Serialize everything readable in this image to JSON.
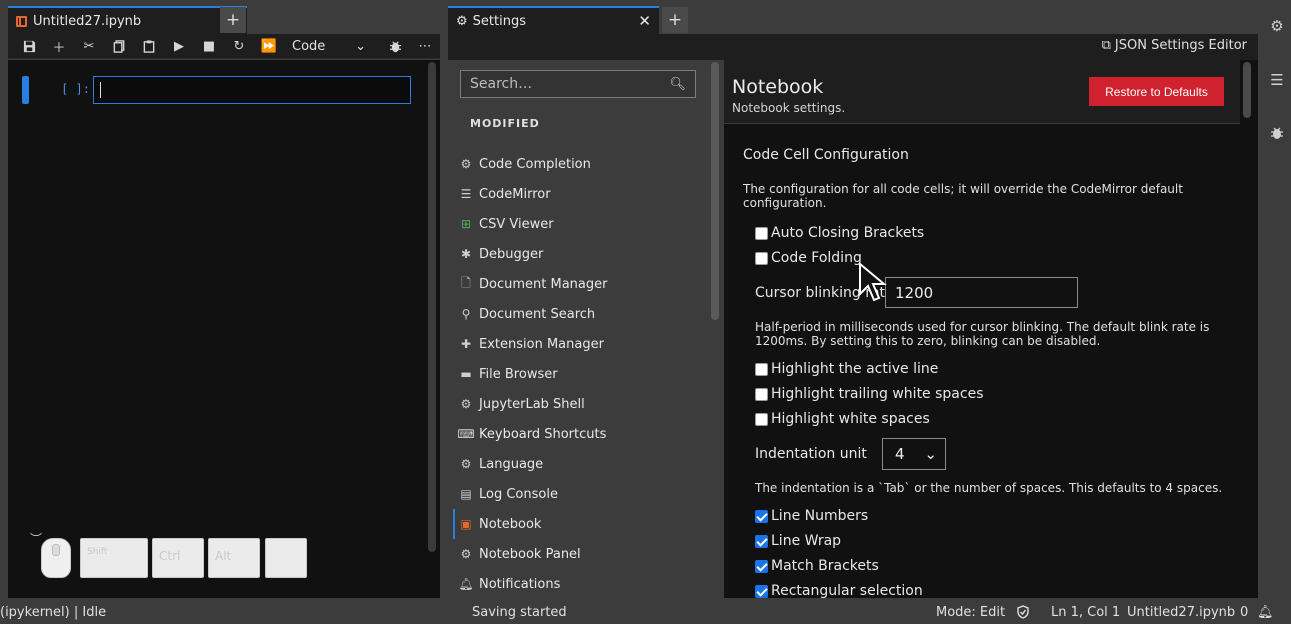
{
  "notebook_tab": {
    "title": "Untitled27.ipynb"
  },
  "toolbar": {
    "cell_type": "Code"
  },
  "cell": {
    "prompt": "[ ]:"
  },
  "key_overlay": {
    "keys": [
      "Shift",
      "Ctrl",
      "Alt",
      ""
    ]
  },
  "settings_tab": {
    "title": "Settings"
  },
  "settings_header": {
    "json_editor_label": "JSON Settings Editor"
  },
  "search": {
    "placeholder": "Search…"
  },
  "plugin_list": {
    "section_header": "MODIFIED",
    "items": [
      {
        "label": "Code Completion",
        "icon": "gear-icon"
      },
      {
        "label": "CodeMirror",
        "icon": "text-lines-icon"
      },
      {
        "label": "CSV Viewer",
        "icon": "spreadsheet-icon"
      },
      {
        "label": "Debugger",
        "icon": "bug-icon"
      },
      {
        "label": "Document Manager",
        "icon": "file-icon"
      },
      {
        "label": "Document Search",
        "icon": "search-icon"
      },
      {
        "label": "Extension Manager",
        "icon": "puzzle-icon"
      },
      {
        "label": "File Browser",
        "icon": "folder-icon"
      },
      {
        "label": "JupyterLab Shell",
        "icon": "gear-icon"
      },
      {
        "label": "Keyboard Shortcuts",
        "icon": "keyboard-icon"
      },
      {
        "label": "Language",
        "icon": "gear-icon"
      },
      {
        "label": "Log Console",
        "icon": "list-icon"
      },
      {
        "label": "Notebook",
        "icon": "notebook-icon"
      },
      {
        "label": "Notebook Panel",
        "icon": "gear-icon"
      },
      {
        "label": "Notifications",
        "icon": "bell-icon"
      }
    ]
  },
  "settings_panel": {
    "title": "Notebook",
    "subtitle": "Notebook settings.",
    "restore_label": "Restore to Defaults",
    "section_title": "Code Cell Configuration",
    "section_desc": "The configuration for all code cells; it will override the CodeMirror default configuration.",
    "checkboxes_top": [
      {
        "label": "Auto Closing Brackets",
        "checked": false
      },
      {
        "label": "Code Folding",
        "checked": false
      }
    ],
    "blink_label": "Cursor blinking rate",
    "blink_value": "1200",
    "blink_desc": "Half-period in milliseconds used for cursor blinking. The default blink rate is 1200ms. By setting this to zero, blinking can be disabled.",
    "checkboxes_mid": [
      {
        "label": "Highlight the active line",
        "checked": false
      },
      {
        "label": "Highlight trailing white spaces",
        "checked": false
      },
      {
        "label": "Highlight white spaces",
        "checked": false
      }
    ],
    "indent_label": "Indentation unit",
    "indent_value": "4",
    "indent_desc": "The indentation is a `Tab` or the number of spaces. This defaults to 4 spaces.",
    "checkboxes_bottom": [
      {
        "label": "Line Numbers",
        "checked": true
      },
      {
        "label": "Line Wrap",
        "checked": true
      },
      {
        "label": "Match Brackets",
        "checked": true
      },
      {
        "label": "Rectangular selection",
        "checked": true
      }
    ]
  },
  "statusbar": {
    "kernel": "(ipykernel) | Idle",
    "saving": "Saving started",
    "mode": "Mode: Edit",
    "position": "Ln 1, Col 1",
    "file": "Untitled27.ipynb",
    "notifications": "0"
  },
  "colors": {
    "accent": "#2a7de1",
    "restore": "#d0212e",
    "notebook_icon": "#e4682d"
  }
}
